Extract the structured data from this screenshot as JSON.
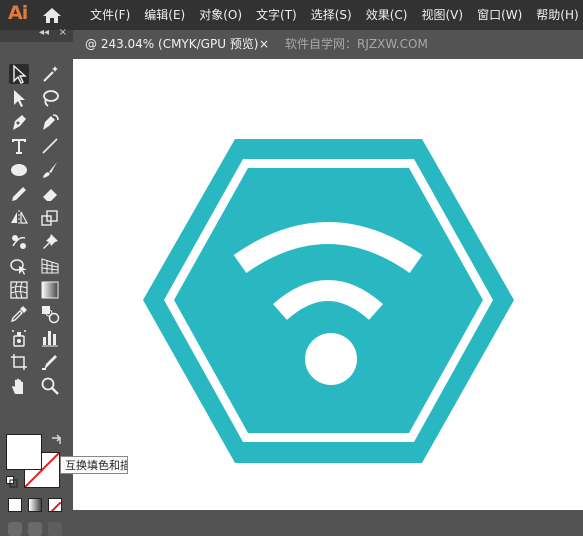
{
  "app": {
    "logo_text": "Ai",
    "brand_color": "#e07b39"
  },
  "menu": {
    "items": [
      "文件(F)",
      "编辑(E)",
      "对象(O)",
      "文字(T)",
      "选择(S)",
      "效果(C)",
      "视图(V)",
      "窗口(W)",
      "帮助(H)"
    ]
  },
  "tabs": {
    "active_label": "@ 243.04% (CMYK/GPU 预览)",
    "close_glyph": "×",
    "second_label": "软件自学网：RJZXW.COM"
  },
  "toolbar": {
    "collapse_glyph": "◂◂",
    "close_glyph": "×",
    "tools": [
      "selection-tool",
      "magic-wand-tool",
      "direct-selection-tool",
      "lasso-tool",
      "pen-tool",
      "curvature-tool",
      "type-tool",
      "line-tool",
      "ellipse-tool",
      "paintbrush-tool",
      "pencil-tool",
      "eraser-tool",
      "reflect-tool",
      "scale-tool",
      "puppet-warp-tool",
      "pin-tool",
      "shape-builder-tool",
      "perspective-grid-tool",
      "mesh-tool",
      "gradient-tool",
      "eyedropper-tool",
      "blend-tool",
      "symbol-sprayer-tool",
      "column-graph-tool",
      "artboard-tool",
      "slice-tool",
      "hand-tool",
      "zoom-tool"
    ]
  },
  "color": {
    "fill": "#ffffff",
    "stroke": "none",
    "tooltip": "互换填色和描边"
  },
  "artwork": {
    "color": "#29b8c2",
    "background": "#ffffff",
    "icon": "wifi-hexagon"
  }
}
